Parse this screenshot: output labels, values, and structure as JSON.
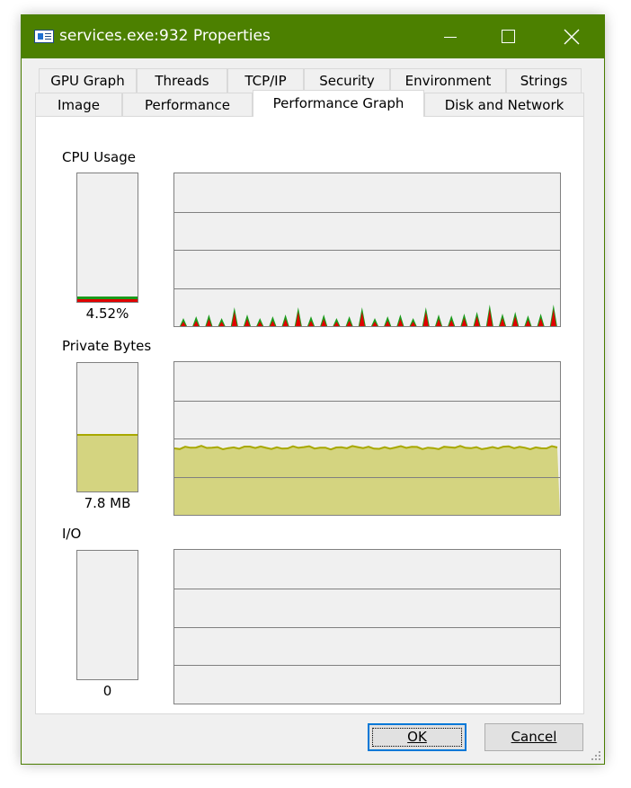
{
  "window": {
    "title": "services.exe:932 Properties",
    "accent_color": "#4c8000"
  },
  "tabs": {
    "row1": [
      "GPU Graph",
      "Threads",
      "TCP/IP",
      "Security",
      "Environment",
      "Strings"
    ],
    "row2": [
      "Image",
      "Performance",
      "Performance Graph",
      "Disk and Network"
    ],
    "active": "Performance Graph"
  },
  "cpu": {
    "label": "CPU Usage",
    "value_text": "4.52%",
    "percent": 4.52,
    "kernel_color": "#e00000",
    "user_color": "#1a9a1a"
  },
  "private_bytes": {
    "label": "Private Bytes",
    "value_text": "7.8 MB",
    "level_fraction": 0.44,
    "fill_color": "#d4d480",
    "line_color": "#a8a800"
  },
  "io": {
    "label": "I/O",
    "value_text": "0"
  },
  "buttons": {
    "ok_label": "OK",
    "cancel_label": "Cancel"
  }
}
